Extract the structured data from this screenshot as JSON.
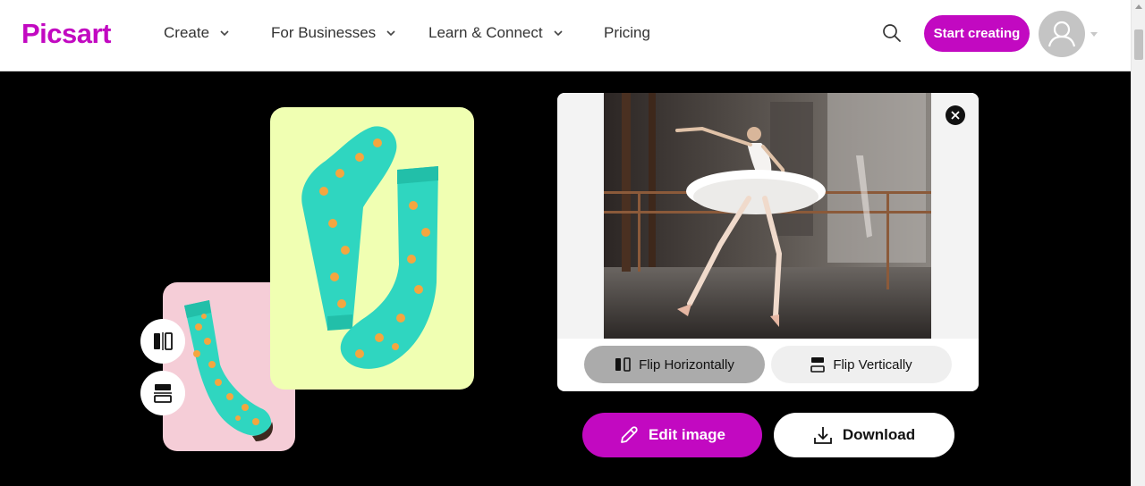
{
  "header": {
    "logo": "Picsart",
    "nav": [
      {
        "label": "Create",
        "has_dropdown": true
      },
      {
        "label": "For Businesses",
        "has_dropdown": true
      },
      {
        "label": "Learn & Connect",
        "has_dropdown": true
      },
      {
        "label": "Pricing",
        "has_dropdown": false
      }
    ],
    "search_icon": "search-icon",
    "start_button": "Start creating",
    "avatar_icon": "user-icon"
  },
  "illustration": {
    "flip_horizontal_icon": "flip-horizontal-icon",
    "flip_vertical_icon": "flip-vertical-icon"
  },
  "preview": {
    "close_icon": "close-icon",
    "flip_horizontal": "Flip Horizontally",
    "flip_vertical": "Flip Vertically"
  },
  "actions": {
    "edit": "Edit image",
    "edit_icon": "pencil-icon",
    "download": "Download",
    "download_icon": "download-icon"
  },
  "colors": {
    "brand": "#c209c1",
    "pink_card": "#f5cdd7",
    "yellow_card": "#f0ffb2",
    "sock": "#2fd6c0"
  }
}
